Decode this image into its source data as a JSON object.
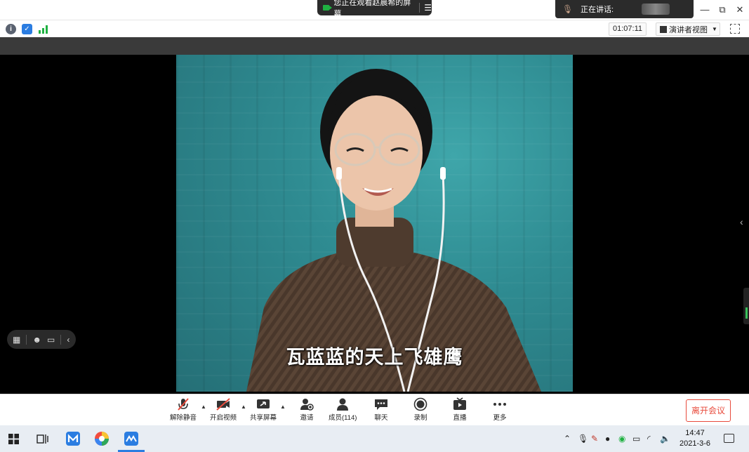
{
  "titlebar": {
    "sharing_text": "您正在观看赵晨希的屏幕",
    "speaking_label": "正在讲话:",
    "window_controls": [
      "minimize",
      "restore",
      "close"
    ]
  },
  "infobar": {
    "timer": "01:07:11",
    "view_label": "演讲者视图"
  },
  "video": {
    "subtitle": "瓦蓝蓝的天上飞雄鹰"
  },
  "toolbar": {
    "items": [
      {
        "label": "解除静音",
        "icon": "mic-muted-icon"
      },
      {
        "label": "开启视频",
        "icon": "video-off-icon"
      },
      {
        "label": "共享屏幕",
        "icon": "share-screen-icon"
      },
      {
        "label": "邀请",
        "icon": "invite-icon"
      },
      {
        "label": "成员(114)",
        "icon": "members-icon"
      },
      {
        "label": "聊天",
        "icon": "chat-icon"
      },
      {
        "label": "录制",
        "icon": "record-icon"
      },
      {
        "label": "直播",
        "icon": "live-icon"
      },
      {
        "label": "更多",
        "icon": "more-icon"
      }
    ],
    "leave_label": "离开会议"
  },
  "taskbar": {
    "time": "14:47",
    "date": "2021-3-6"
  },
  "colors": {
    "accent_red": "#e84b3c",
    "live_green": "#1fb141",
    "taskbar_bg": "#e8edf3"
  }
}
